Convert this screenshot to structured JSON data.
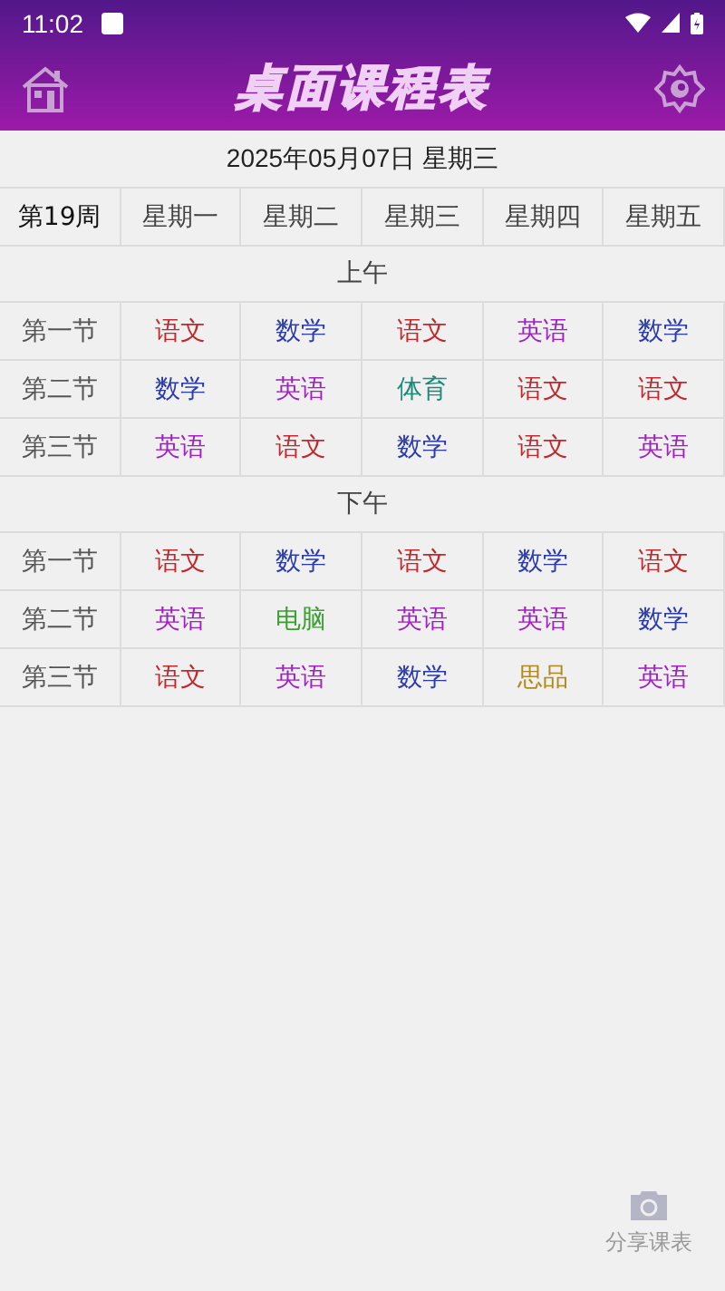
{
  "status_bar": {
    "time": "11:02"
  },
  "app_bar": {
    "title": "桌面课程表"
  },
  "date": "2025年05月07日 星期三",
  "table": {
    "columns": [
      "第19周",
      "星期一",
      "星期二",
      "星期三",
      "星期四",
      "星期五"
    ],
    "sections": [
      {
        "title": "上午",
        "rows": [
          {
            "label": "第一节",
            "cells": [
              {
                "subject": "语文",
                "color": "#c0282c"
              },
              {
                "subject": "数学",
                "color": "#2a3aa8"
              },
              {
                "subject": "语文",
                "color": "#c0282c"
              },
              {
                "subject": "英语",
                "color": "#a020c0"
              },
              {
                "subject": "数学",
                "color": "#2a3aa8"
              }
            ]
          },
          {
            "label": "第二节",
            "cells": [
              {
                "subject": "数学",
                "color": "#2a3aa8"
              },
              {
                "subject": "英语",
                "color": "#a020c0"
              },
              {
                "subject": "体育",
                "color": "#1a8a7a"
              },
              {
                "subject": "语文",
                "color": "#c0282c"
              },
              {
                "subject": "语文",
                "color": "#c0282c"
              }
            ]
          },
          {
            "label": "第三节",
            "cells": [
              {
                "subject": "英语",
                "color": "#a020c0"
              },
              {
                "subject": "语文",
                "color": "#c0282c"
              },
              {
                "subject": "数学",
                "color": "#2a3aa8"
              },
              {
                "subject": "语文",
                "color": "#c0282c"
              },
              {
                "subject": "英语",
                "color": "#a020c0"
              }
            ]
          }
        ]
      },
      {
        "title": "下午",
        "rows": [
          {
            "label": "第一节",
            "cells": [
              {
                "subject": "语文",
                "color": "#c0282c"
              },
              {
                "subject": "数学",
                "color": "#2a3aa8"
              },
              {
                "subject": "语文",
                "color": "#c0282c"
              },
              {
                "subject": "数学",
                "color": "#2a3aa8"
              },
              {
                "subject": "语文",
                "color": "#c0282c"
              }
            ]
          },
          {
            "label": "第二节",
            "cells": [
              {
                "subject": "英语",
                "color": "#a020c0"
              },
              {
                "subject": "电脑",
                "color": "#3aa030"
              },
              {
                "subject": "英语",
                "color": "#a020c0"
              },
              {
                "subject": "英语",
                "color": "#a020c0"
              },
              {
                "subject": "数学",
                "color": "#2a3aa8"
              }
            ]
          },
          {
            "label": "第三节",
            "cells": [
              {
                "subject": "语文",
                "color": "#c0282c"
              },
              {
                "subject": "英语",
                "color": "#a020c0"
              },
              {
                "subject": "数学",
                "color": "#2a3aa8"
              },
              {
                "subject": "思品",
                "color": "#b08a20"
              },
              {
                "subject": "英语",
                "color": "#a020c0"
              }
            ]
          }
        ]
      }
    ]
  },
  "share_button": {
    "label": "分享课表"
  }
}
